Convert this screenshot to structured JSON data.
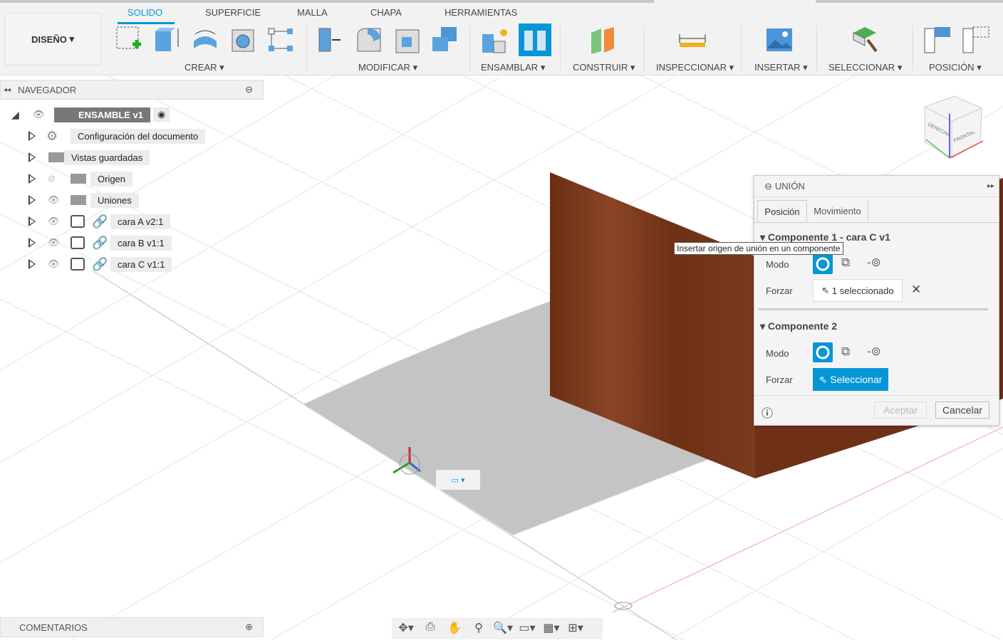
{
  "toolbar": {
    "workspace": "DISEÑO",
    "tabs": [
      "SOLIDO",
      "SUPERFICIE",
      "MALLA",
      "CHAPA",
      "HERRAMIENTAS"
    ],
    "active_tab": "SOLIDO",
    "groups": [
      "CREAR",
      "MODIFICAR",
      "ENSAMBLAR",
      "CONSTRUIR",
      "INSPECCIONAR",
      "INSERTAR",
      "SELECCIONAR",
      "POSICIÓN"
    ],
    "accent": "#0696d7"
  },
  "navigator": {
    "title": "NAVEGADOR",
    "root": "ENSAMBLE v1",
    "items": [
      {
        "label": "Configuración del documento",
        "icon": "gear-icon"
      },
      {
        "label": "Vistas guardadas",
        "icon": "folder-icon"
      },
      {
        "label": "Origen",
        "icon": "folder-icon",
        "hidden": true
      },
      {
        "label": "Uniones",
        "icon": "folder-icon"
      },
      {
        "label": "cara A v2:1",
        "icon": "component-icon"
      },
      {
        "label": "cara B v1:1",
        "icon": "component-icon"
      },
      {
        "label": "cara C v1:1",
        "icon": "component-icon"
      }
    ]
  },
  "comments": {
    "title": "COMENTARIOS"
  },
  "joint_dialog": {
    "title": "UNIÓN",
    "tabs": [
      "Posición",
      "Movimiento"
    ],
    "comp1": {
      "title": "Componente 1 - cara C v1",
      "mode_label": "Modo",
      "snap_label": "Forzar",
      "snap_value": "1 seleccionado"
    },
    "comp2": {
      "title": "Componente 2",
      "mode_label": "Modo",
      "snap_label": "Forzar",
      "snap_value": "Seleccionar"
    },
    "ok": "Aceptar",
    "cancel": "Cancelar"
  },
  "tooltip": "Insertar origen de unión en un componente",
  "viewcube": {
    "front": "FRONTAL",
    "right": "DERECHA"
  }
}
